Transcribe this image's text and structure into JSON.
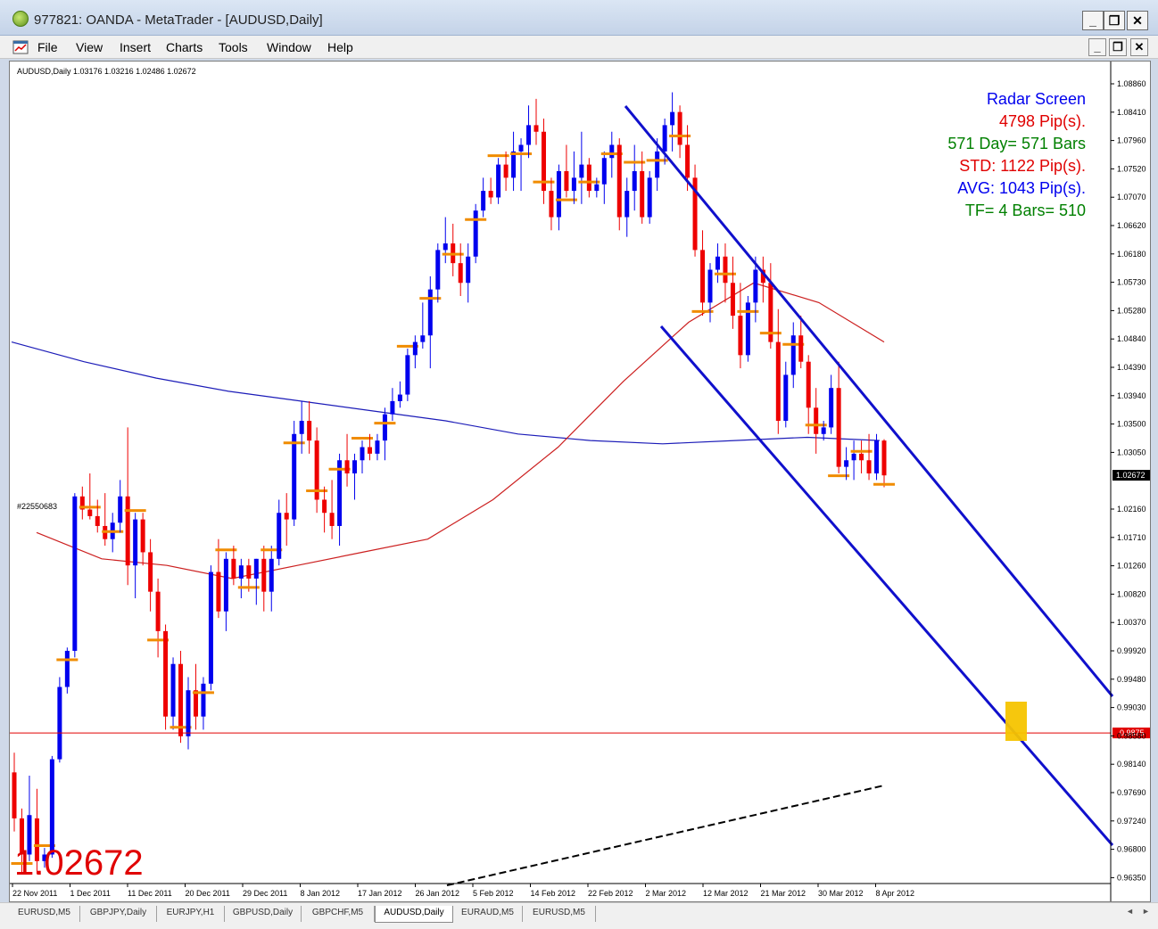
{
  "window": {
    "title": "977821: OANDA - MetaTrader - [AUDUSD,Daily]",
    "min": "_",
    "restore": "❐",
    "close": "✕"
  },
  "menu": {
    "items": [
      "File",
      "View",
      "Insert",
      "Charts",
      "Tools",
      "Window",
      "Help"
    ]
  },
  "chart": {
    "info": "AUDUSD,Daily  1.03176 1.03216 1.02486 1.02672",
    "big_price": "1.02672",
    "order_label": "#22550683",
    "price_labels": [
      "1.08860",
      "1.08410",
      "1.07960",
      "1.07520",
      "1.07070",
      "1.06620",
      "1.06180",
      "1.05730",
      "1.05280",
      "1.04840",
      "1.04390",
      "1.03940",
      "1.03500",
      "1.03050",
      "1.02672",
      "1.02160",
      "1.01710",
      "1.01260",
      "1.00820",
      "1.00370",
      "0.99920",
      "0.99480",
      "0.99030",
      "0.98580",
      "0.98140",
      "0.97690",
      "0.97240",
      "0.96800",
      "0.96350"
    ],
    "date_labels": [
      "22 Nov 2011",
      "1 Dec 2011",
      "11 Dec 2011",
      "20 Dec 2011",
      "29 Dec 2011",
      "8 Jan 2012",
      "17 Jan 2012",
      "26 Jan 2012",
      "5 Feb 2012",
      "14 Feb 2012",
      "22 Feb 2012",
      "2 Mar 2012",
      "12 Mar 2012",
      "21 Mar 2012",
      "30 Mar 2012",
      "8 Apr 2012"
    ],
    "current_price_tag": "1.02672",
    "hline_tag": "0.9875",
    "radar": [
      {
        "text": "Radar Screen",
        "color": "#0000ee"
      },
      {
        "text": "4798 Pip(s).",
        "color": "#e00000"
      },
      {
        "text": "571 Day= 571 Bars",
        "color": "#008000"
      },
      {
        "text": "STD: 1122 Pip(s).",
        "color": "#e00000"
      },
      {
        "text": "AVG: 1043 Pip(s).",
        "color": "#0000ee"
      },
      {
        "text": "TF= 4 Bars= 510",
        "color": "#008000"
      }
    ]
  },
  "tabs": [
    "EURUSD,M5",
    "GBPJPY,Daily",
    "EURJPY,H1",
    "GBPUSD,Daily",
    "GBPCHF,M5",
    "AUDUSD,Daily",
    "EURAUD,M5",
    "EURUSD,M5"
  ],
  "active_tab": "AUDUSD,Daily",
  "chart_data": {
    "type": "candlestick",
    "symbol": "AUDUSD",
    "timeframe": "Daily",
    "ylim": [
      0.9635,
      1.0886
    ],
    "current": 1.02672,
    "hline": 0.9875,
    "candles": [
      [
        0.9815,
        0.9845,
        0.9725,
        0.9745
      ],
      [
        0.9745,
        0.976,
        0.966,
        0.969
      ],
      [
        0.969,
        0.981,
        0.968,
        0.975
      ],
      [
        0.9745,
        0.979,
        0.966,
        0.968
      ],
      [
        0.968,
        0.97,
        0.967,
        0.969
      ],
      [
        0.969,
        0.984,
        0.9685,
        0.9835
      ],
      [
        0.9835,
        0.996,
        0.983,
        0.9945
      ],
      [
        0.9945,
        1.0005,
        0.9935,
        1.0
      ],
      [
        1.0,
        1.024,
        0.999,
        1.0235
      ],
      [
        1.0235,
        1.025,
        1.02,
        1.0215
      ],
      [
        1.0215,
        1.027,
        1.02,
        1.0205
      ],
      [
        1.0205,
        1.023,
        1.018,
        1.019
      ],
      [
        1.019,
        1.024,
        1.016,
        1.017
      ],
      [
        1.017,
        1.021,
        1.015,
        1.0195
      ],
      [
        1.0195,
        1.026,
        1.018,
        1.0235
      ],
      [
        1.0235,
        1.034,
        1.01,
        1.013
      ],
      [
        1.013,
        1.021,
        1.008,
        1.02
      ],
      [
        1.02,
        1.021,
        1.013,
        1.015
      ],
      [
        1.015,
        1.017,
        1.006,
        1.009
      ],
      [
        1.009,
        1.011,
        0.999,
        1.003
      ],
      [
        1.003,
        1.004,
        0.988,
        0.99
      ],
      [
        0.99,
        0.999,
        0.988,
        0.998
      ],
      [
        0.998,
        1.0,
        0.986,
        0.987
      ],
      [
        0.987,
        0.996,
        0.985,
        0.994
      ],
      [
        0.994,
        0.998,
        0.988,
        0.99
      ],
      [
        0.99,
        0.996,
        0.988,
        0.995
      ],
      [
        0.995,
        1.013,
        0.994,
        1.012
      ],
      [
        1.012,
        1.017,
        1.005,
        1.006
      ],
      [
        1.006,
        1.015,
        1.003,
        1.014
      ],
      [
        1.014,
        1.016,
        1.01,
        1.011
      ],
      [
        1.011,
        1.014,
        1.008,
        1.013
      ],
      [
        1.013,
        1.014,
        1.009,
        1.011
      ],
      [
        1.011,
        1.014,
        1.007,
        1.014
      ],
      [
        1.014,
        1.016,
        1.006,
        1.009
      ],
      [
        1.009,
        1.016,
        1.006,
        1.014
      ],
      [
        1.014,
        1.023,
        1.013,
        1.021
      ],
      [
        1.021,
        1.024,
        1.016,
        1.02
      ],
      [
        1.02,
        1.035,
        1.019,
        1.033
      ],
      [
        1.033,
        1.038,
        1.03,
        1.035
      ],
      [
        1.035,
        1.038,
        1.03,
        1.032
      ],
      [
        1.032,
        1.034,
        1.021,
        1.023
      ],
      [
        1.023,
        1.025,
        1.018,
        1.021
      ],
      [
        1.021,
        1.026,
        1.017,
        1.019
      ],
      [
        1.019,
        1.03,
        1.016,
        1.029
      ],
      [
        1.029,
        1.033,
        1.025,
        1.027
      ],
      [
        1.027,
        1.03,
        1.023,
        1.029
      ],
      [
        1.029,
        1.032,
        1.027,
        1.031
      ],
      [
        1.031,
        1.033,
        1.029,
        1.03
      ],
      [
        1.03,
        1.033,
        1.029,
        1.032
      ],
      [
        1.032,
        1.037,
        1.029,
        1.036
      ],
      [
        1.036,
        1.04,
        1.035,
        1.038
      ],
      [
        1.038,
        1.041,
        1.037,
        1.039
      ],
      [
        1.039,
        1.046,
        1.038,
        1.045
      ],
      [
        1.045,
        1.048,
        1.043,
        1.047
      ],
      [
        1.047,
        1.053,
        1.046,
        1.048
      ],
      [
        1.048,
        1.057,
        1.043,
        1.055
      ],
      [
        1.055,
        1.062,
        1.053,
        1.061
      ],
      [
        1.061,
        1.066,
        1.059,
        1.062
      ],
      [
        1.062,
        1.065,
        1.057,
        1.059
      ],
      [
        1.059,
        1.062,
        1.054,
        1.056
      ],
      [
        1.056,
        1.062,
        1.053,
        1.06
      ],
      [
        1.06,
        1.068,
        1.059,
        1.067
      ],
      [
        1.067,
        1.072,
        1.066,
        1.07
      ],
      [
        1.07,
        1.072,
        1.068,
        1.069
      ],
      [
        1.069,
        1.075,
        1.068,
        1.074
      ],
      [
        1.074,
        1.076,
        1.07,
        1.072
      ],
      [
        1.072,
        1.079,
        1.07,
        1.076
      ],
      [
        1.076,
        1.078,
        1.07,
        1.077
      ],
      [
        1.077,
        1.083,
        1.075,
        1.08
      ],
      [
        1.08,
        1.084,
        1.077,
        1.079
      ],
      [
        1.079,
        1.081,
        1.068,
        1.07
      ],
      [
        1.07,
        1.072,
        1.064,
        1.066
      ],
      [
        1.066,
        1.074,
        1.064,
        1.073
      ],
      [
        1.073,
        1.077,
        1.069,
        1.07
      ],
      [
        1.07,
        1.076,
        1.068,
        1.072
      ],
      [
        1.072,
        1.079,
        1.068,
        1.074
      ],
      [
        1.074,
        1.075,
        1.069,
        1.07
      ],
      [
        1.07,
        1.072,
        1.069,
        1.071
      ],
      [
        1.071,
        1.076,
        1.068,
        1.075
      ],
      [
        1.075,
        1.079,
        1.072,
        1.077
      ],
      [
        1.077,
        1.078,
        1.064,
        1.066
      ],
      [
        1.066,
        1.072,
        1.063,
        1.07
      ],
      [
        1.07,
        1.077,
        1.067,
        1.073
      ],
      [
        1.073,
        1.076,
        1.065,
        1.066
      ],
      [
        1.066,
        1.073,
        1.065,
        1.072
      ],
      [
        1.072,
        1.078,
        1.07,
        1.076
      ],
      [
        1.076,
        1.081,
        1.074,
        1.08
      ],
      [
        1.08,
        1.085,
        1.076,
        1.082
      ],
      [
        1.082,
        1.083,
        1.075,
        1.077
      ],
      [
        1.077,
        1.08,
        1.07,
        1.072
      ],
      [
        1.072,
        1.074,
        1.06,
        1.061
      ],
      [
        1.061,
        1.064,
        1.051,
        1.053
      ],
      [
        1.053,
        1.059,
        1.05,
        1.058
      ],
      [
        1.058,
        1.062,
        1.056,
        1.06
      ],
      [
        1.06,
        1.062,
        1.053,
        1.056
      ],
      [
        1.056,
        1.06,
        1.049,
        1.051
      ],
      [
        1.051,
        1.056,
        1.043,
        1.045
      ],
      [
        1.045,
        1.054,
        1.044,
        1.053
      ],
      [
        1.053,
        1.06,
        1.05,
        1.058
      ],
      [
        1.058,
        1.06,
        1.053,
        1.056
      ],
      [
        1.056,
        1.059,
        1.046,
        1.047
      ],
      [
        1.047,
        1.052,
        1.033,
        1.035
      ],
      [
        1.035,
        1.044,
        1.034,
        1.042
      ],
      [
        1.042,
        1.05,
        1.04,
        1.048
      ],
      [
        1.048,
        1.051,
        1.043,
        1.044
      ],
      [
        1.044,
        1.045,
        1.033,
        1.037
      ],
      [
        1.037,
        1.04,
        1.03,
        1.033
      ],
      [
        1.033,
        1.035,
        1.032,
        1.034
      ],
      [
        1.034,
        1.042,
        1.033,
        1.04
      ],
      [
        1.04,
        1.044,
        1.027,
        1.028
      ],
      [
        1.028,
        1.031,
        1.026,
        1.029
      ],
      [
        1.029,
        1.032,
        1.026,
        1.03
      ],
      [
        1.03,
        1.032,
        1.027,
        1.029
      ],
      [
        1.029,
        1.033,
        1.026,
        1.027
      ],
      [
        1.027,
        1.033,
        1.026,
        1.032
      ],
      [
        1.032,
        1.0322,
        1.0249,
        1.0267
      ]
    ],
    "ma_slow": [
      1.047,
      1.044,
      1.0415,
      1.0395,
      1.038,
      1.0365,
      1.035,
      1.033,
      1.032,
      1.0315,
      1.032,
      1.0325,
      1.032
    ],
    "ma_fast": [
      1.018,
      1.014,
      1.013,
      1.011,
      1.013,
      1.015,
      1.017,
      1.023,
      1.031,
      1.041,
      1.05,
      1.056,
      1.053,
      1.047
    ]
  }
}
